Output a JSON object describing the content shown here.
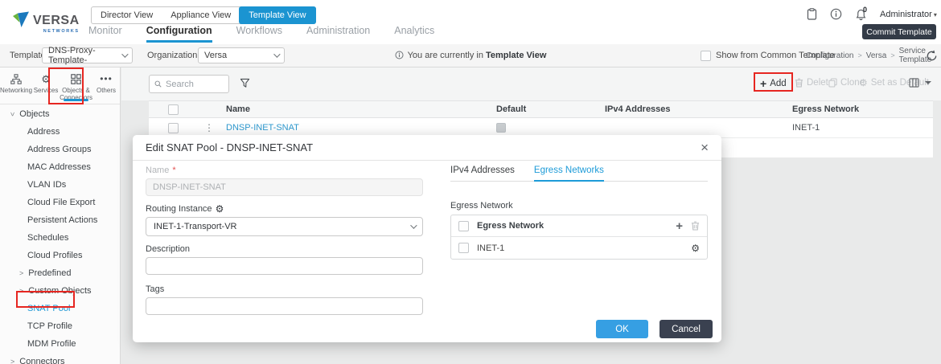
{
  "brand": {
    "name": "VERSA",
    "sub": "NETWORKS"
  },
  "header": {
    "view_tabs": [
      {
        "label": "Director View",
        "active": false
      },
      {
        "label": "Appliance View",
        "active": false
      },
      {
        "label": "Template View",
        "active": true
      }
    ],
    "nav_tabs": [
      {
        "label": "Monitor",
        "active": false
      },
      {
        "label": "Configuration",
        "active": true
      },
      {
        "label": "Workflows",
        "active": false
      },
      {
        "label": "Administration",
        "active": false
      },
      {
        "label": "Analytics",
        "active": false
      }
    ],
    "notification_count": "0",
    "user_menu": "Administrator",
    "commit_button": "Commit Template"
  },
  "context_bar": {
    "template_label": "Template",
    "template_value": "DNS-Proxy-Template-",
    "organization_label": "Organization",
    "organization_value": "Versa",
    "notice_prefix": "You are currently in",
    "notice_bold": "Template View",
    "show_common_label": "Show from Common Template",
    "breadcrumb": [
      "Configuration",
      "Versa",
      "Service Template"
    ]
  },
  "sidebar": {
    "tabs": [
      {
        "label": "Networking",
        "active": false
      },
      {
        "label": "Services",
        "active": false
      },
      {
        "label": "Objects & Connectors",
        "active": true
      },
      {
        "label": "Others",
        "active": false
      }
    ],
    "tree": [
      {
        "label": "Objects"
      },
      {
        "label": "Address"
      },
      {
        "label": "Address Groups"
      },
      {
        "label": "MAC Addresses"
      },
      {
        "label": "VLAN IDs"
      },
      {
        "label": "Cloud File Export"
      },
      {
        "label": "Persistent Actions"
      },
      {
        "label": "Schedules"
      },
      {
        "label": "Cloud Profiles"
      },
      {
        "label": "Predefined"
      },
      {
        "label": "Custom Objects"
      },
      {
        "label": "SNAT Pool",
        "active": true
      },
      {
        "label": "TCP Profile"
      },
      {
        "label": "MDM Profile"
      },
      {
        "label": "Connectors"
      }
    ]
  },
  "toolbar": {
    "search_placeholder": "Search",
    "add_label": "Add",
    "delete_label": "Delete",
    "clone_label": "Clone",
    "set_default_label": "Set as Default"
  },
  "table": {
    "columns": [
      "Name",
      "Default",
      "IPv4 Addresses",
      "Egress Network"
    ],
    "rows": [
      {
        "name": "DNSP-INET-SNAT",
        "default": true,
        "ipv4": "",
        "egress": "INET-1"
      }
    ]
  },
  "modal": {
    "title": "Edit SNAT Pool - DNSP-INET-SNAT",
    "name_label": "Name",
    "required_mark": "*",
    "name_value": "DNSP-INET-SNAT",
    "routing_label": "Routing Instance",
    "routing_value": "INET-1-Transport-VR",
    "description_label": "Description",
    "tags_label": "Tags",
    "tabs": [
      {
        "label": "IPv4 Addresses",
        "active": false
      },
      {
        "label": "Egress Networks",
        "active": true
      }
    ],
    "egress_section_label": "Egress Network",
    "egress_table_header": "Egress Network",
    "egress_rows": [
      {
        "name": "INET-1"
      }
    ],
    "ok_label": "OK",
    "cancel_label": "Cancel"
  },
  "colors": {
    "accent": "#1b94d1",
    "link": "#2f9ad0",
    "ok_button": "#369fe3",
    "cancel_button": "#3a4150",
    "commit_button": "#333b47",
    "annotation": "#e62621"
  }
}
